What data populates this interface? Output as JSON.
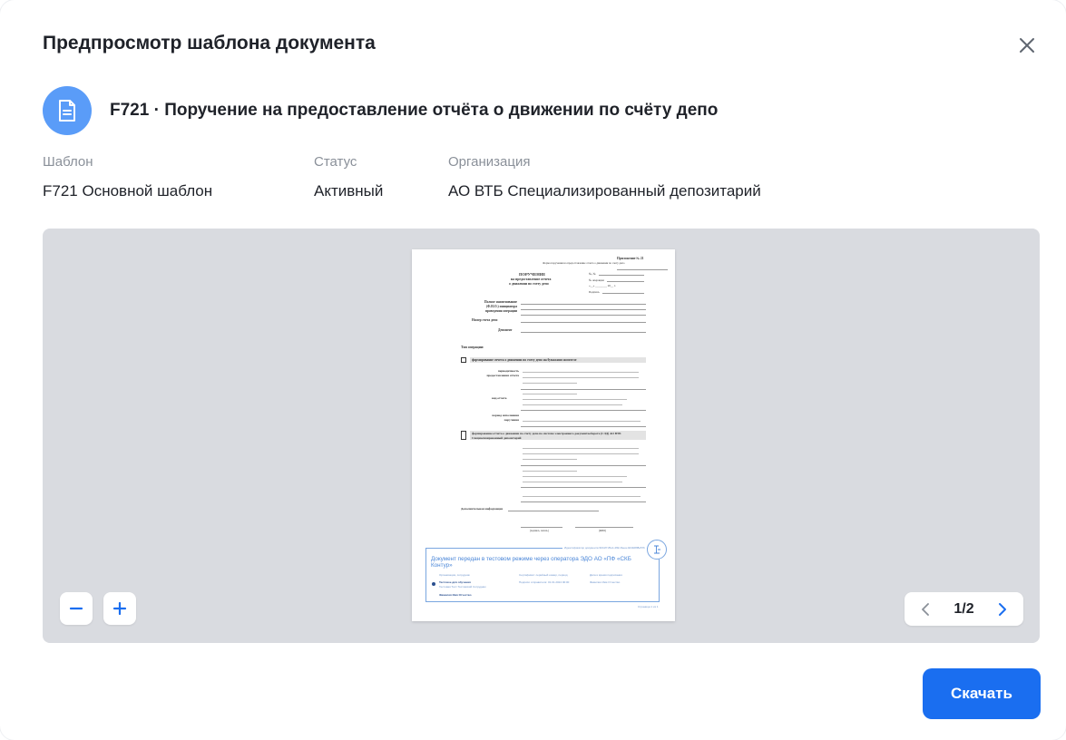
{
  "modal": {
    "title": "Предпросмотр шаблона документа",
    "close_icon": "close-icon"
  },
  "document": {
    "icon": "document-icon",
    "title": "F721 · Поручение на предоставление отчёта о движении по счёту депо"
  },
  "meta": {
    "template_label": "Шаблон",
    "template_value": "F721 Основной шаблон",
    "status_label": "Статус",
    "status_value": "Активный",
    "org_label": "Организация",
    "org_value": "АО ВТБ Специализированный депозитарий"
  },
  "viewer": {
    "page_indicator": "1/2",
    "zoom_out_icon": "minus-icon",
    "zoom_in_icon": "plus-icon",
    "prev_icon": "chevron-left-icon",
    "next_icon": "chevron-right-icon"
  },
  "page_preview": {
    "appendix": "Приложение № 21",
    "form_note": "Форма поручения на предоставление отчета о движении по счету депо",
    "heading": "ПОРУЧЕНИЕ",
    "heading2": "на предоставление отчета",
    "heading3": "о движении по счету депо",
    "num_label": "№, №",
    "reg_label": "№ операции",
    "date_label": "«__» ________ 20__ г.",
    "sign_label": "Подпись",
    "full_name_label": "Полное наименование (Ф.И.О.) инициатора проведения операции",
    "account_label": "Номер счета депо",
    "depositor_label": "Депонент",
    "op_type_label": "Тип операции:",
    "paper_label": "формирование отчета о движении по счету депо на бумажном носителе",
    "periodicity_label": "периодичность предоставления отчета",
    "report_type_label": "вид отчета",
    "period_label": "период исполнения поручения",
    "electronic_label": "формирование отчета о движении по счету депо по системе электронного документооборота (СЭД) АО ВТБ Специализированный депозитарий",
    "extra_info_label": "Дополнительная информация",
    "sign_name_label": "(подпись, печать)",
    "fio_label": "(ФИО)",
    "stamp_top": "Идентификатор документа 9bb1f7-8fe1-4f9c-8eea-0d43d8f8e57b",
    "stamp_title": "Документ передан в тестовом режиме через оператора ЭДО АО «ПФ «СКБ Контур»",
    "stamp_col1": "Организация, сотрудник",
    "stamp_col2": "Сертификат: серийный номер, период",
    "stamp_col3": "Дата и время подписания",
    "stamp_row1a": "Тестовое для обучения",
    "stamp_row1b": "Тестовая Тест Тестовский Сотрудник",
    "stamp_row2": "Подписи отправителя: 01.01.2024 00:00",
    "stamp_link": "Фамилия Имя Отчество",
    "stamp_page": "Страница 1 из 1"
  }
}
